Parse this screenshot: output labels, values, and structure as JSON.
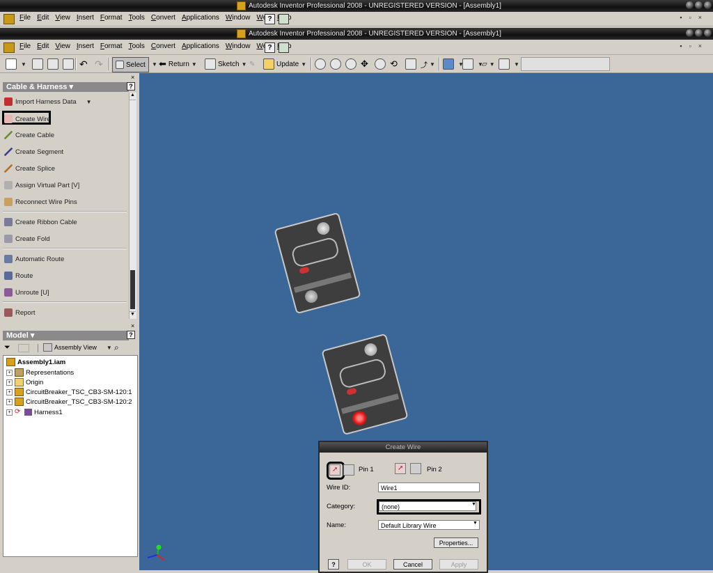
{
  "outer_window": {
    "title": "Autodesk Inventor Professional 2008 - UNREGISTERED VERSION - [Assembly1]"
  },
  "inner_window": {
    "title": "Autodesk Inventor Professional 2008 - UNREGISTERED VERSION - [Assembly1]"
  },
  "menu": [
    "File",
    "Edit",
    "View",
    "Insert",
    "Format",
    "Tools",
    "Convert",
    "Applications",
    "Window",
    "Web",
    "Help"
  ],
  "toolbar": {
    "select_label": "Select",
    "return_label": "Return",
    "sketch_label": "Sketch",
    "update_label": "Update"
  },
  "browser_panel": {
    "title": "Cable & Harness",
    "items": [
      {
        "label": "Import Harness Data",
        "icon": "import-harness-icon"
      },
      {
        "label": "Create Wire",
        "icon": "wire-icon"
      },
      {
        "label": "Create Cable",
        "icon": "cable-icon"
      },
      {
        "label": "Create Segment",
        "icon": "segment-icon"
      },
      {
        "label": "Create Splice",
        "icon": "splice-icon"
      },
      {
        "label": "Assign Virtual Part   [V]",
        "icon": "virtual-part-icon"
      },
      {
        "label": "Reconnect Wire Pins",
        "icon": "reconnect-icon"
      },
      {
        "label": "Create Ribbon Cable",
        "icon": "ribbon-cable-icon"
      },
      {
        "label": "Create Fold",
        "icon": "fold-icon"
      },
      {
        "label": "Automatic Route",
        "icon": "auto-route-icon"
      },
      {
        "label": "Route",
        "icon": "route-icon"
      },
      {
        "label": "Unroute    [U]",
        "icon": "unroute-icon"
      },
      {
        "label": "Report",
        "icon": "report-icon"
      }
    ]
  },
  "model_panel": {
    "title": "Model",
    "view_label": "Assembly View",
    "tree": [
      {
        "label": "Assembly1.iam"
      },
      {
        "label": "Representations"
      },
      {
        "label": "Origin"
      },
      {
        "label": "CircuitBreaker_TSC_CB3-SM-120:1"
      },
      {
        "label": "CircuitBreaker_TSC_CB3-SM-120:2"
      },
      {
        "label": "Harness1"
      }
    ]
  },
  "dialog": {
    "title": "Create Wire",
    "pin1_label": "Pin 1",
    "pin2_label": "Pin 2",
    "wire_id_label": "Wire ID:",
    "wire_id_value": "Wire1",
    "category_label": "Category:",
    "category_value": "(none)",
    "name_label": "Name:",
    "name_value": "Default Library Wire",
    "properties_label": "Properties...",
    "ok_label": "OK",
    "cancel_label": "Cancel",
    "apply_label": "Apply",
    "help_label": "?"
  },
  "colors": {
    "viewport": "#3b6798",
    "highlight": "#000000",
    "panel_header": "#8a8a8a"
  }
}
